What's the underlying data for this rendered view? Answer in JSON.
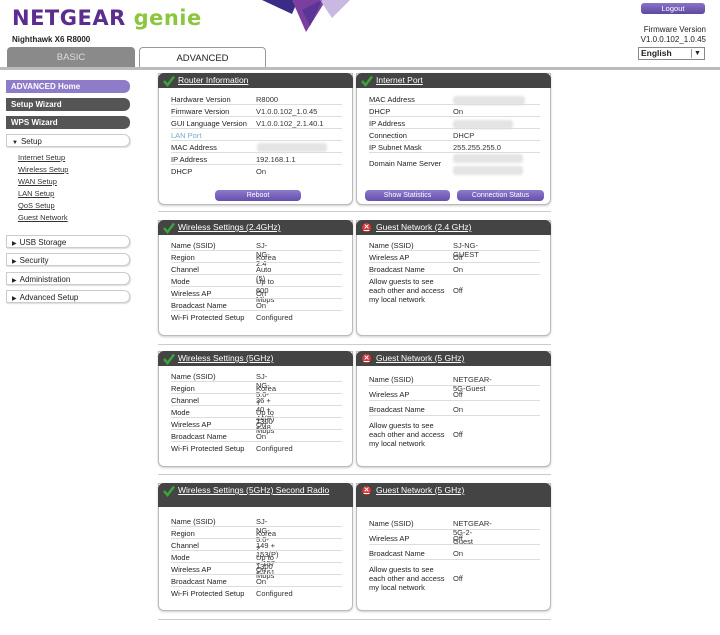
{
  "header": {
    "brand": "NETGEAR",
    "product": "genie",
    "model": "Nighthawk X6 R8000",
    "logout": "Logout",
    "firmware_label": "Firmware Version",
    "firmware_value": "V1.0.0.102_1.0.45",
    "language": "English"
  },
  "tabs": {
    "basic": "BASIC",
    "advanced": "ADVANCED"
  },
  "sidebar": {
    "advanced_home": "ADVANCED Home",
    "setup_wizard": "Setup Wizard",
    "wps_wizard": "WPS Wizard",
    "setup": "Setup",
    "setup_items": [
      "Internet Setup",
      "Wireless Setup",
      "WAN Setup",
      "LAN Setup",
      "QoS Setup",
      "Guest Network"
    ],
    "usb_storage": "USB Storage",
    "security": "Security",
    "administration": "Administration",
    "advanced_setup": "Advanced Setup"
  },
  "router_info": {
    "title": "Router Information",
    "rows": [
      {
        "k": "Hardware Version",
        "v": "R8000"
      },
      {
        "k": "Firmware Version",
        "v": "V1.0.0.102_1.0.45"
      },
      {
        "k": "GUI Language Version",
        "v": "V1.0.0.102_2.1.40.1"
      },
      {
        "k": "LAN Port",
        "v": ""
      },
      {
        "k": "MAC Address",
        "v": ""
      },
      {
        "k": "IP Address",
        "v": "192.168.1.1"
      },
      {
        "k": "DHCP",
        "v": "On"
      }
    ],
    "reboot": "Reboot"
  },
  "internet_port": {
    "title": "Internet Port",
    "rows": [
      {
        "k": "MAC Address",
        "v": ""
      },
      {
        "k": "DHCP",
        "v": "On"
      },
      {
        "k": "IP Address",
        "v": ""
      },
      {
        "k": "Connection",
        "v": "DHCP"
      },
      {
        "k": "IP Subnet Mask",
        "v": "255.255.255.0"
      },
      {
        "k": "Domain Name Server",
        "v": ""
      }
    ],
    "show_stats": "Show Statistics",
    "conn_status": "Connection Status"
  },
  "wifi24": {
    "title": "Wireless Settings (2.4GHz)",
    "rows": [
      {
        "k": "Name (SSID)",
        "v": "SJ-NG-2.4"
      },
      {
        "k": "Region",
        "v": "Korea"
      },
      {
        "k": "Channel",
        "v": "Auto (5)"
      },
      {
        "k": "Mode",
        "v": "Up to 600 Mbps"
      },
      {
        "k": "Wireless AP",
        "v": "On"
      },
      {
        "k": "Broadcast Name",
        "v": "On"
      },
      {
        "k": "Wi-Fi Protected Setup",
        "v": "Configured"
      }
    ]
  },
  "guest24": {
    "title": "Guest Network (2.4 GHz)",
    "rows": [
      {
        "k": "Name (SSID)",
        "v": "SJ-NG-GUEST"
      },
      {
        "k": "Wireless AP",
        "v": "Off"
      },
      {
        "k": "Broadcast Name",
        "v": "On"
      }
    ],
    "allow_label": "Allow guests to see each other and access my local network",
    "allow_value": "Off"
  },
  "wifi5": {
    "title": "Wireless Settings (5GHz)",
    "rows": [
      {
        "k": "Name (SSID)",
        "v": "SJ-NG-5.0-1"
      },
      {
        "k": "Region",
        "v": "Korea"
      },
      {
        "k": "Channel",
        "v": "36 + 40 + 44(P) + 48"
      },
      {
        "k": "Mode",
        "v": "Up to 1300 Mbps"
      },
      {
        "k": "Wireless AP",
        "v": "On"
      },
      {
        "k": "Broadcast Name",
        "v": "On"
      },
      {
        "k": "Wi-Fi Protected Setup",
        "v": "Configured"
      }
    ]
  },
  "guest5": {
    "title": "Guest Network (5 GHz)",
    "rows": [
      {
        "k": "Name (SSID)",
        "v": "NETGEAR-5G-Guest"
      },
      {
        "k": "Wireless AP",
        "v": "Off"
      },
      {
        "k": "Broadcast Name",
        "v": "On"
      }
    ],
    "allow_label": "Allow guests to see each other and access my local network",
    "allow_value": "Off"
  },
  "wifi5b": {
    "title": "Wireless Settings (5GHz) Second Radio",
    "rows": [
      {
        "k": "Name (SSID)",
        "v": "SJ-NG-5.0-2"
      },
      {
        "k": "Region",
        "v": "Korea"
      },
      {
        "k": "Channel",
        "v": "149 + 153(P) + 157 + 161"
      },
      {
        "k": "Mode",
        "v": "Up to 1300 Mbps"
      },
      {
        "k": "Wireless AP",
        "v": "On"
      },
      {
        "k": "Broadcast Name",
        "v": "On"
      },
      {
        "k": "Wi-Fi Protected Setup",
        "v": "Configured"
      }
    ]
  },
  "guest5b": {
    "title": "Guest Network (5 GHz)",
    "rows": [
      {
        "k": "Name (SSID)",
        "v": "NETGEAR-5G-2-Guest"
      },
      {
        "k": "Wireless AP",
        "v": "Off"
      },
      {
        "k": "Broadcast Name",
        "v": "On"
      }
    ],
    "allow_label": "Allow guests to see each other and access my local network",
    "allow_value": "Off"
  },
  "colors": {
    "brand_purple": "#5b2d8e",
    "brand_green": "#8cc63f",
    "panel_header": "#444444",
    "status_ok": "#3aa63a",
    "status_off": "#dd3333"
  }
}
